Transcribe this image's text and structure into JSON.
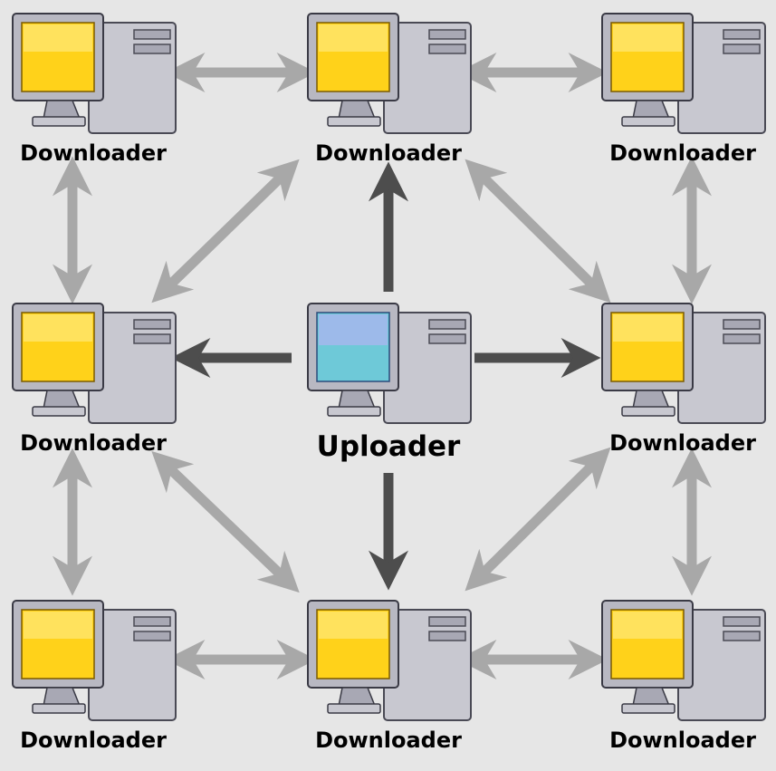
{
  "nodes": {
    "top_left": {
      "label": "Downloader",
      "role": "downloader"
    },
    "top_center": {
      "label": "Downloader",
      "role": "downloader"
    },
    "top_right": {
      "label": "Downloader",
      "role": "downloader"
    },
    "middle_left": {
      "label": "Downloader",
      "role": "downloader"
    },
    "center": {
      "label": "Uploader",
      "role": "uploader"
    },
    "middle_right": {
      "label": "Downloader",
      "role": "downloader"
    },
    "bottom_left": {
      "label": "Downloader",
      "role": "downloader"
    },
    "bottom_center": {
      "label": "Downloader",
      "role": "downloader"
    },
    "bottom_right": {
      "label": "Downloader",
      "role": "downloader"
    }
  },
  "colors": {
    "background": "#e6e6e6",
    "uploader_arrow": "#4d4d4d",
    "peer_arrow": "#a8a8a8",
    "downloader_screen": "#ffd21a",
    "uploader_screen": "#6ec9d8"
  }
}
